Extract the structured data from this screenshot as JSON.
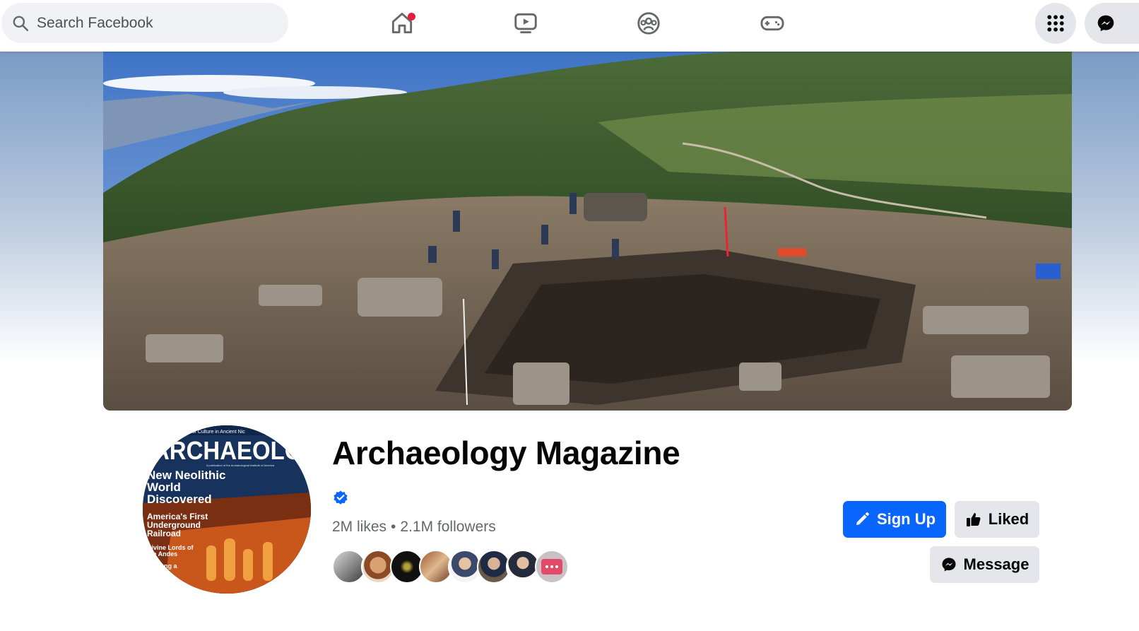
{
  "topbar": {
    "search_placeholder": "Search Facebook",
    "nav": [
      {
        "name": "home",
        "icon": "home-icon",
        "has_notification": true
      },
      {
        "name": "video",
        "icon": "video-icon"
      },
      {
        "name": "groups",
        "icon": "groups-icon"
      },
      {
        "name": "gaming",
        "icon": "gaming-icon"
      }
    ],
    "menu_icon": "grid-menu-icon",
    "messenger_icon": "messenger-icon"
  },
  "page": {
    "title": "Archaeology Magazine",
    "verified": true,
    "likes": "2M likes",
    "separator": "•",
    "followers": "2.1M followers",
    "friend_avatar_count": 8
  },
  "profile_pic": {
    "masthead": "ARCHAEOLOGY",
    "tagline": "of Culture in Ancient Nic",
    "publisher_line": "A publication of the Archaeological Institute of America",
    "headline_1": "New Neolithic World Discovered",
    "headline_2": "America's First Underground Railroad",
    "headline_3": "Divine Lords of the Andes",
    "headline_4": "ng a"
  },
  "actions": {
    "signup_label": "Sign Up",
    "liked_label": "Liked",
    "message_label": "Message"
  },
  "colors": {
    "brand_blue": "#0866ff",
    "button_grey": "#e4e6eb",
    "notification_red": "#e41e3f"
  }
}
